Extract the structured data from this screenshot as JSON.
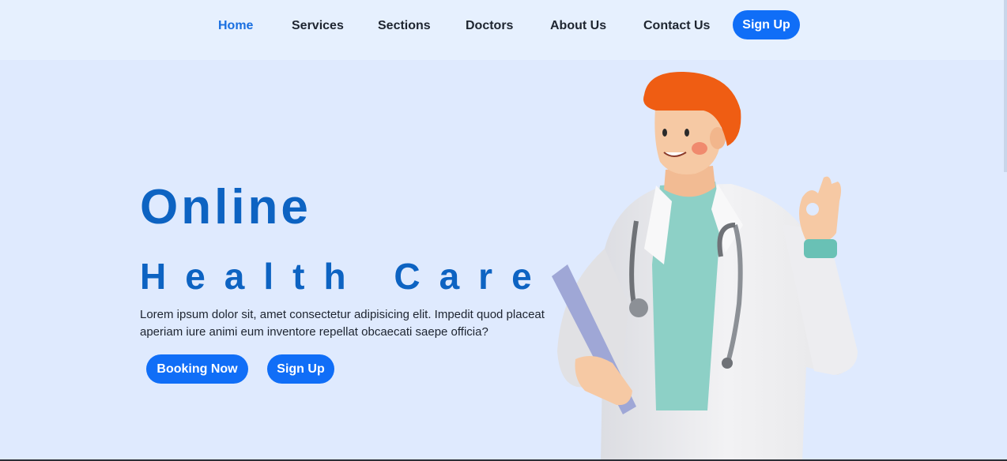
{
  "nav": {
    "items": [
      {
        "label": "Home",
        "active": true
      },
      {
        "label": "Services"
      },
      {
        "label": "Sections"
      },
      {
        "label": "Doctors"
      },
      {
        "label": "About Us"
      },
      {
        "label": "Contact Us"
      }
    ],
    "signup_label": "Sign Up"
  },
  "hero": {
    "title_line1": "Online",
    "title_line2": "Health Care",
    "description": "Lorem ipsum dolor sit, amet consectetur adipisicing elit. Impedit quod placeat aperiam iure animi eum inventore repellat obcaecati saepe officia?",
    "booking_label": "Booking Now",
    "signup_label": "Sign Up",
    "illustration_icon": "doctor-illustration"
  },
  "colors": {
    "accent": "#106ef7",
    "title": "#0d63c2",
    "background": "#dfeafe",
    "nav_background": "#e6f0fe"
  }
}
